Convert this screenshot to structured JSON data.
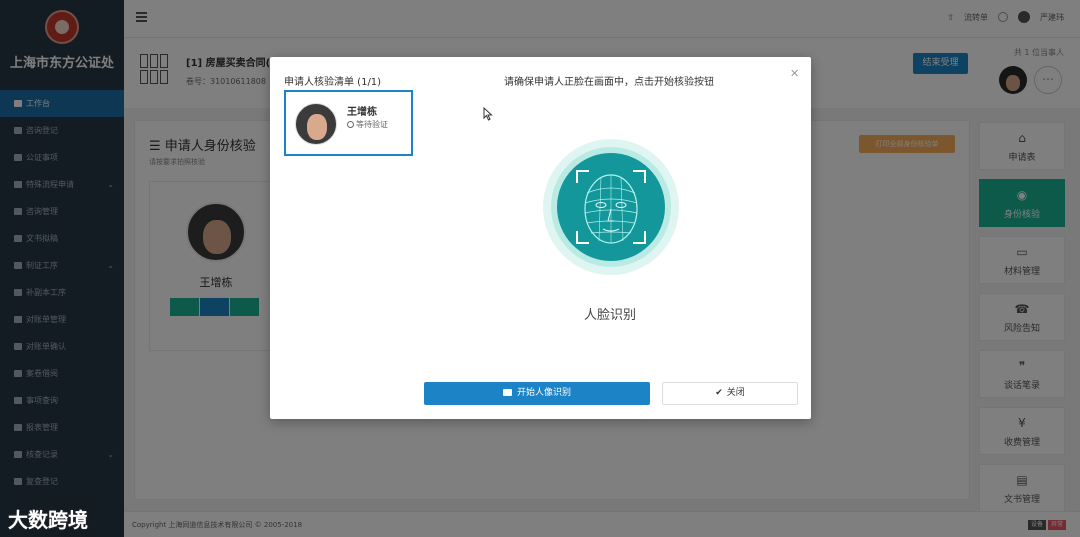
{
  "app": {
    "org_name": "上海市东方公证处",
    "user_name": "严建玮",
    "footer_text": "Copyright 上海同道信息技术有限公司 © 2005-2018",
    "watermark": "大数跨境"
  },
  "sidebar": {
    "items": [
      {
        "label": "工作台",
        "active": true
      },
      {
        "label": "咨询登记"
      },
      {
        "label": "公证事项"
      },
      {
        "label": "特殊流程申请"
      },
      {
        "label": "咨询管理"
      },
      {
        "label": "文书拟稿"
      },
      {
        "label": "制证工序"
      },
      {
        "label": "补副本工序"
      },
      {
        "label": "对账单管理"
      },
      {
        "label": "对账单确认"
      },
      {
        "label": "案卷借阅"
      },
      {
        "label": "事项查询"
      },
      {
        "label": "报表管理"
      },
      {
        "label": "核查记录"
      },
      {
        "label": "复查登记"
      }
    ]
  },
  "topbar": {
    "item1": "流转单",
    "user": "严建玮"
  },
  "case": {
    "title": "[1] 房屋买卖合同(增补)",
    "number": "卷号：31010611808",
    "finish_button": "结束受理",
    "party_count": "共 1 位当事人"
  },
  "main": {
    "title": "申请人身份核验",
    "subtitle": "请按要求拍照核验",
    "print_button": "打印全部身份核验单",
    "person_name": "王增栋"
  },
  "right_nav": {
    "items": [
      {
        "label": "申请表",
        "icon": "home-icon"
      },
      {
        "label": "身份核验",
        "icon": "location-icon",
        "active": true
      },
      {
        "label": "材料管理",
        "icon": "inbox-icon"
      },
      {
        "label": "风险告知",
        "icon": "phone-icon"
      },
      {
        "label": "谈话笔录",
        "icon": "quote-icon"
      },
      {
        "label": "收费管理",
        "icon": "yen-icon"
      },
      {
        "label": "文书管理",
        "icon": "file-icon"
      }
    ]
  },
  "footer": {
    "badge1": "设备",
    "badge2": "异常"
  },
  "modal": {
    "list_title": "申请人核验清单 (1/1)",
    "instruction": "请确保申请人正脸在画面中，点击开始核验按钮",
    "applicant_name": "王增栋",
    "applicant_status": "等待验证",
    "face_label": "人脸识别",
    "start_button": "开始人像识别",
    "close_button": "关闭"
  }
}
